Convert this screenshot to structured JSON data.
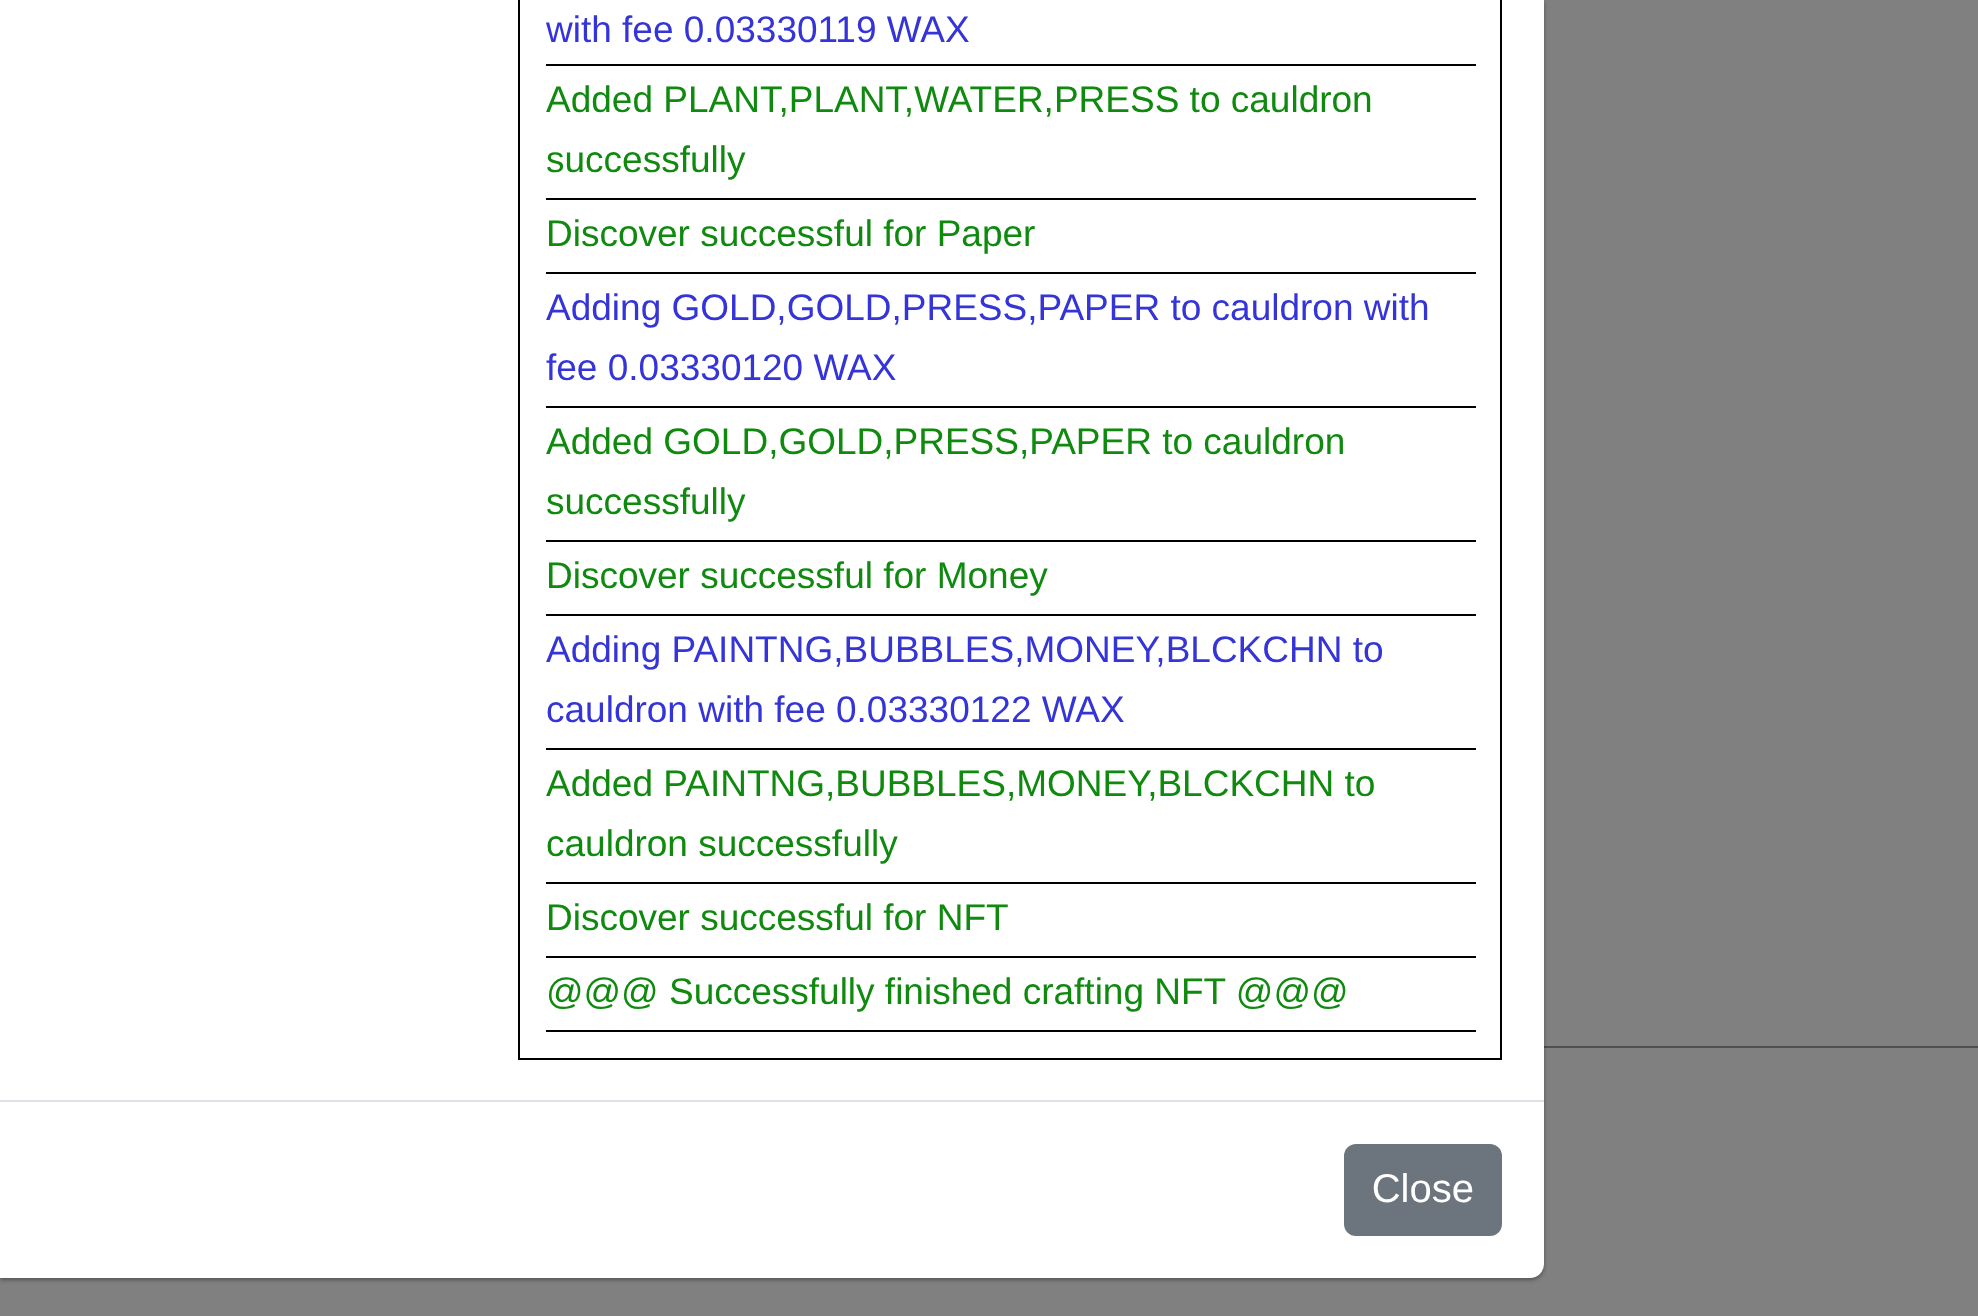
{
  "log": {
    "entries": [
      {
        "text": "with fee 0.03330119 WAX",
        "kind": "info"
      },
      {
        "text": "Added PLANT,PLANT,WATER,PRESS to cauldron successfully",
        "kind": "success"
      },
      {
        "text": "Discover successful for Paper",
        "kind": "success"
      },
      {
        "text": "Adding GOLD,GOLD,PRESS,PAPER to cauldron with fee 0.03330120 WAX",
        "kind": "info"
      },
      {
        "text": "Added GOLD,GOLD,PRESS,PAPER to cauldron successfully",
        "kind": "success"
      },
      {
        "text": "Discover successful for Money",
        "kind": "success"
      },
      {
        "text": "Adding PAINTNG,BUBBLES,MONEY,BLCKCHN to cauldron with fee 0.03330122 WAX",
        "kind": "info"
      },
      {
        "text": "Added PAINTNG,BUBBLES,MONEY,BLCKCHN to cauldron successfully",
        "kind": "success"
      },
      {
        "text": "Discover successful for NFT",
        "kind": "success"
      },
      {
        "text": "@@@ Successfully finished crafting NFT @@@",
        "kind": "success"
      }
    ]
  },
  "footer": {
    "close_button": "Close"
  }
}
